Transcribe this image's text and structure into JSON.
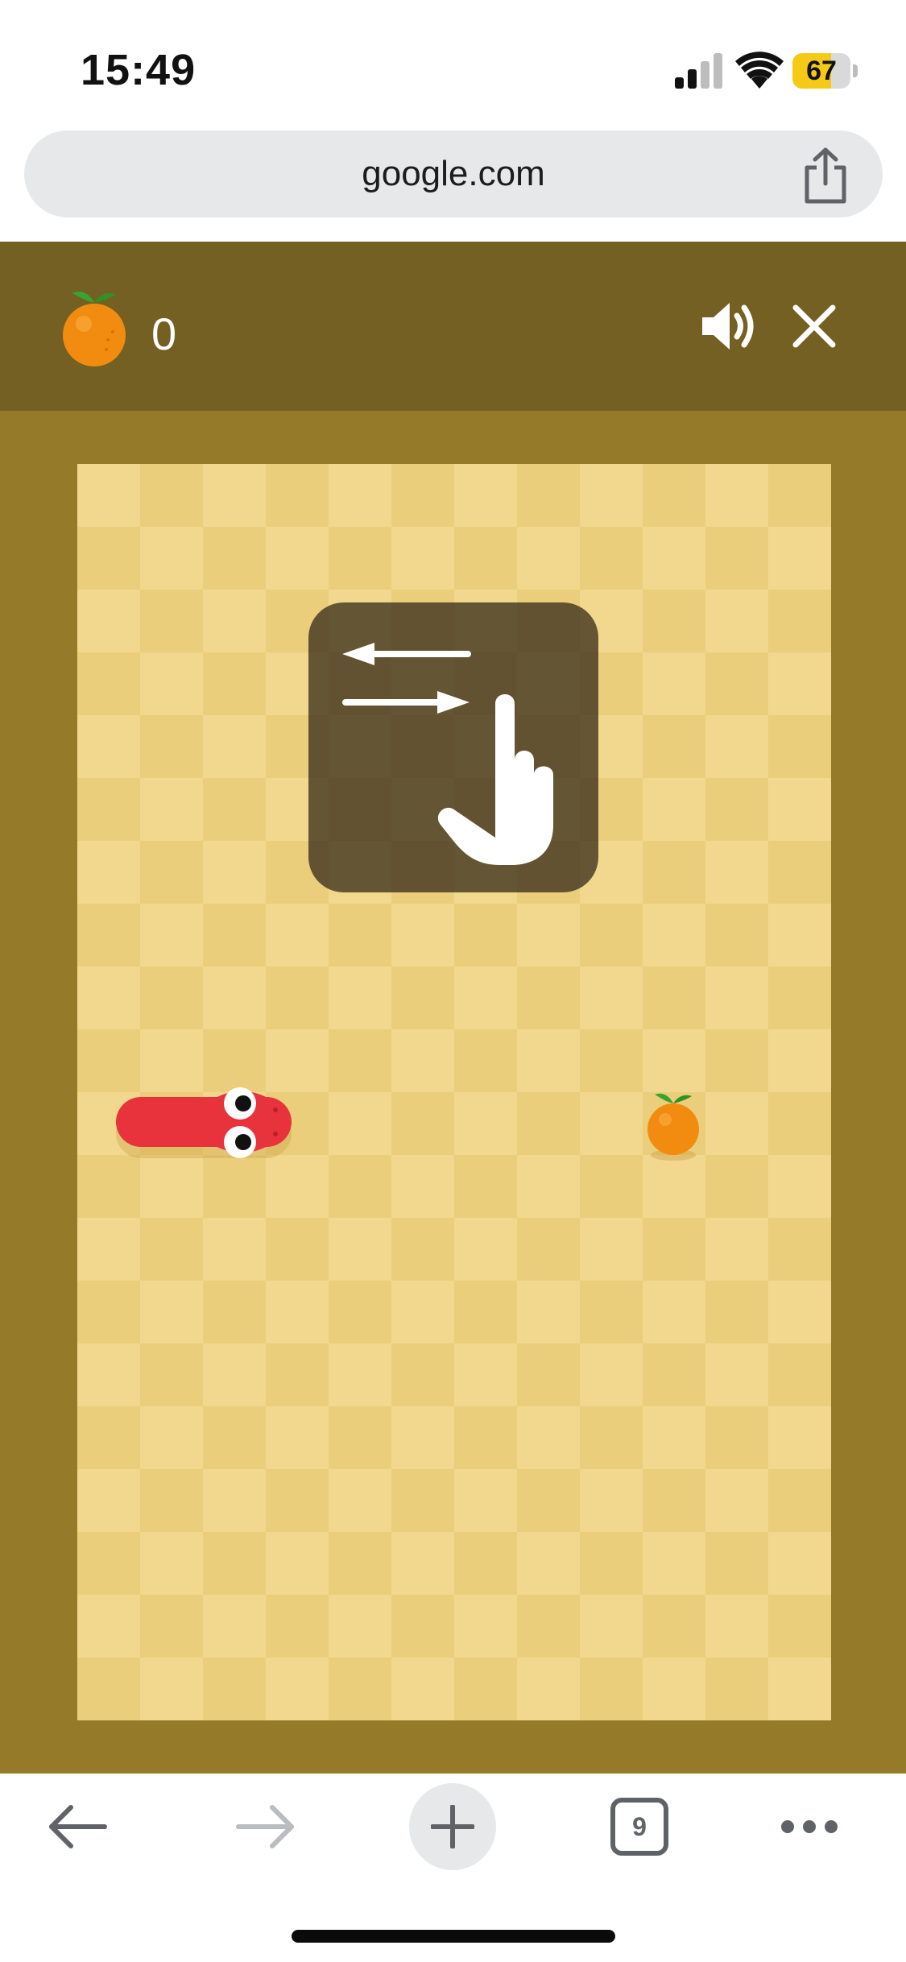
{
  "status_bar": {
    "time": "15:49",
    "battery_level": "67",
    "battery_fraction": 0.67,
    "icons": [
      "cellular-signal-icon",
      "wifi-icon",
      "battery-icon"
    ]
  },
  "browser": {
    "url": "google.com",
    "share_icon": "share-icon"
  },
  "game": {
    "score": "0",
    "score_icon": "orange-fruit-icon",
    "sound_icon": "speaker-on-icon",
    "close_icon": "close-icon",
    "hint_icon": "swipe-left-right-hand-icon",
    "board": {
      "columns": 12,
      "rows": 20
    },
    "snake": {
      "head_col": 3,
      "row": 10,
      "length": 3,
      "direction": "right"
    },
    "fruit": {
      "col": 9,
      "row": 10,
      "type": "orange"
    },
    "colors": {
      "header": "#746022",
      "frame": "#957b29",
      "tile_light": "#f1d88e",
      "tile_dark": "#ebce7b",
      "snake": "#e8323c",
      "fruit": "#f28c11"
    }
  },
  "toolbar": {
    "items": [
      "back-arrow-icon",
      "forward-arrow-icon",
      "new-tab-plus-icon",
      "tab-switcher-icon",
      "more-options-icon"
    ],
    "tab_count": "9"
  }
}
